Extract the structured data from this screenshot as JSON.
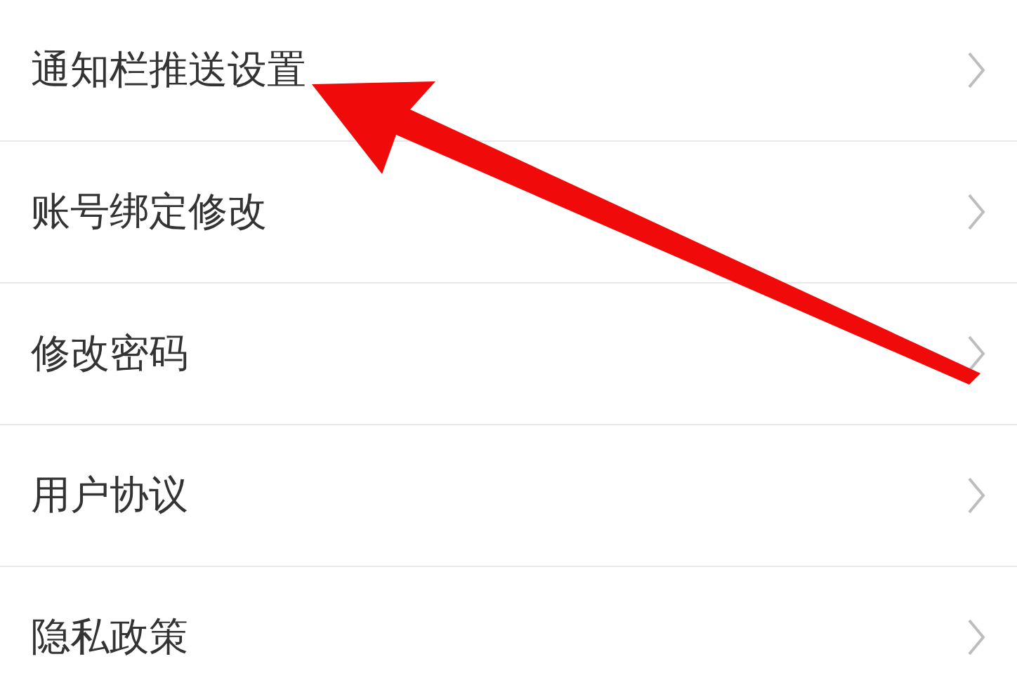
{
  "settings_items": [
    {
      "label": "通知栏推送设置"
    },
    {
      "label": "账号绑定修改"
    },
    {
      "label": "修改密码"
    },
    {
      "label": "用户协议"
    },
    {
      "label": "隐私政策"
    }
  ]
}
